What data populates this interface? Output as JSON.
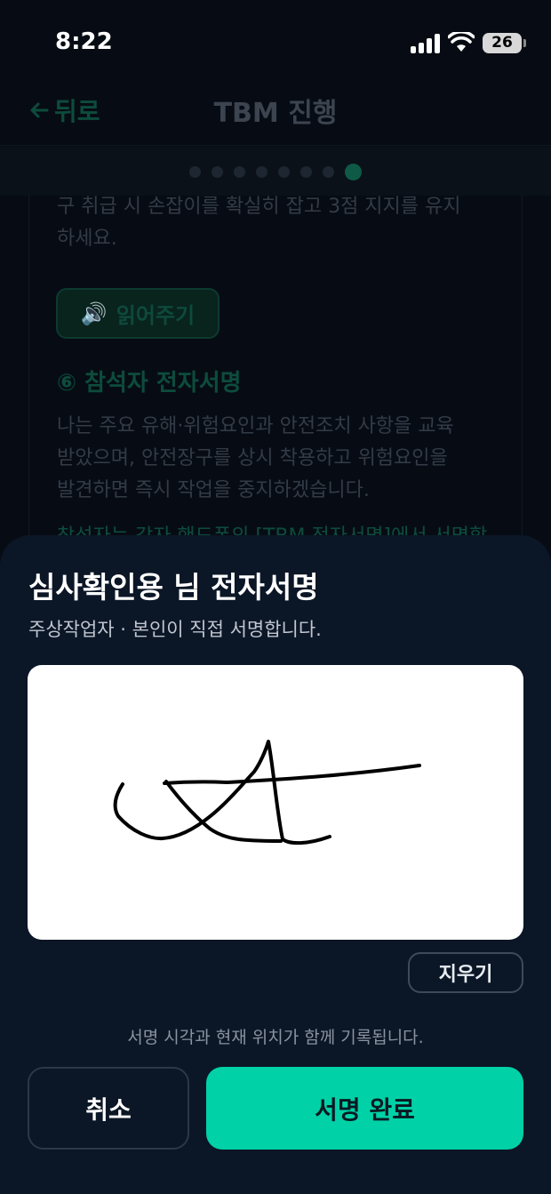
{
  "status_bar": {
    "time": "8:22",
    "battery": "26"
  },
  "header": {
    "back_label": "뒤로",
    "title": "TBM 진행"
  },
  "progress": {
    "total_steps": 8,
    "current_step": 8
  },
  "background": {
    "text_line1": "구 취급 시 손잡이를 확실히 잡고 3점 지지를 유지",
    "text_line2": "하세요.",
    "read_button": "읽어주기",
    "section_number": "⑥",
    "section_title": "참석자 전자서명",
    "pledge_line1": "나는 주요 유해·위험요인과 안전조치 사항을 교육",
    "pledge_line2": "받았으며, 안전장구를 상시 착용하고 위험요인을",
    "pledge_line3": "발견하면 즉시 작업을 중지하겠습니다.",
    "green_note": "참석자는 각자 핸드폰의 [TBM 전자서명]에서 서명합"
  },
  "sheet": {
    "title": "심사확인용 님 전자서명",
    "subtitle": "주상작업자 · 본인이 직접 서명합니다.",
    "clear_button": "지우기",
    "notice": "서명 시각과 현재 위치가 함께 기록됩니다.",
    "cancel_button": "취소",
    "done_button": "서명 완료"
  },
  "colors": {
    "accent": "#00d1a7",
    "sheet_bg": "#0b1626",
    "page_bg": "#070c14"
  }
}
